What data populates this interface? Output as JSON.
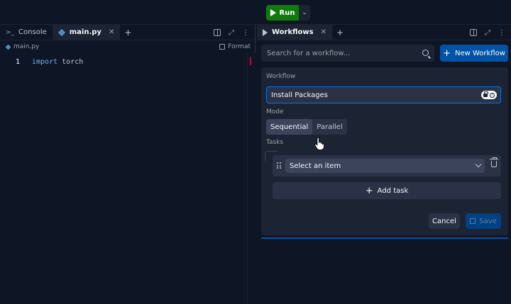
{
  "topbar": {
    "run_label": "Run"
  },
  "left": {
    "tabs": [
      {
        "label": "Console",
        "icon": "terminal-icon"
      },
      {
        "label": "main.py",
        "icon": "python-icon"
      }
    ],
    "file_path": "main.py",
    "format_label": "Format",
    "code": [
      {
        "line": "1",
        "keyword": "import",
        "rest": "torch"
      }
    ]
  },
  "right": {
    "tab_label": "Workflows",
    "search_placeholder": "Search for a workflow...",
    "new_workflow_label": "New Workflow",
    "workflow_label": "Workflow",
    "workflow_name": "Install Packages",
    "mode_label": "Mode",
    "modes": [
      "Sequential",
      "Parallel"
    ],
    "selected_mode": "Sequential",
    "tasks_label": "Tasks",
    "task_select_placeholder": "Select an item",
    "add_task_label": "Add task",
    "cancel_label": "Cancel",
    "save_label": "Save"
  },
  "colors": {
    "run": "#0f7b0f",
    "primary": "#0053a6",
    "focus": "#0079f2",
    "background": "#0e1525",
    "surface": "#1c2333"
  }
}
